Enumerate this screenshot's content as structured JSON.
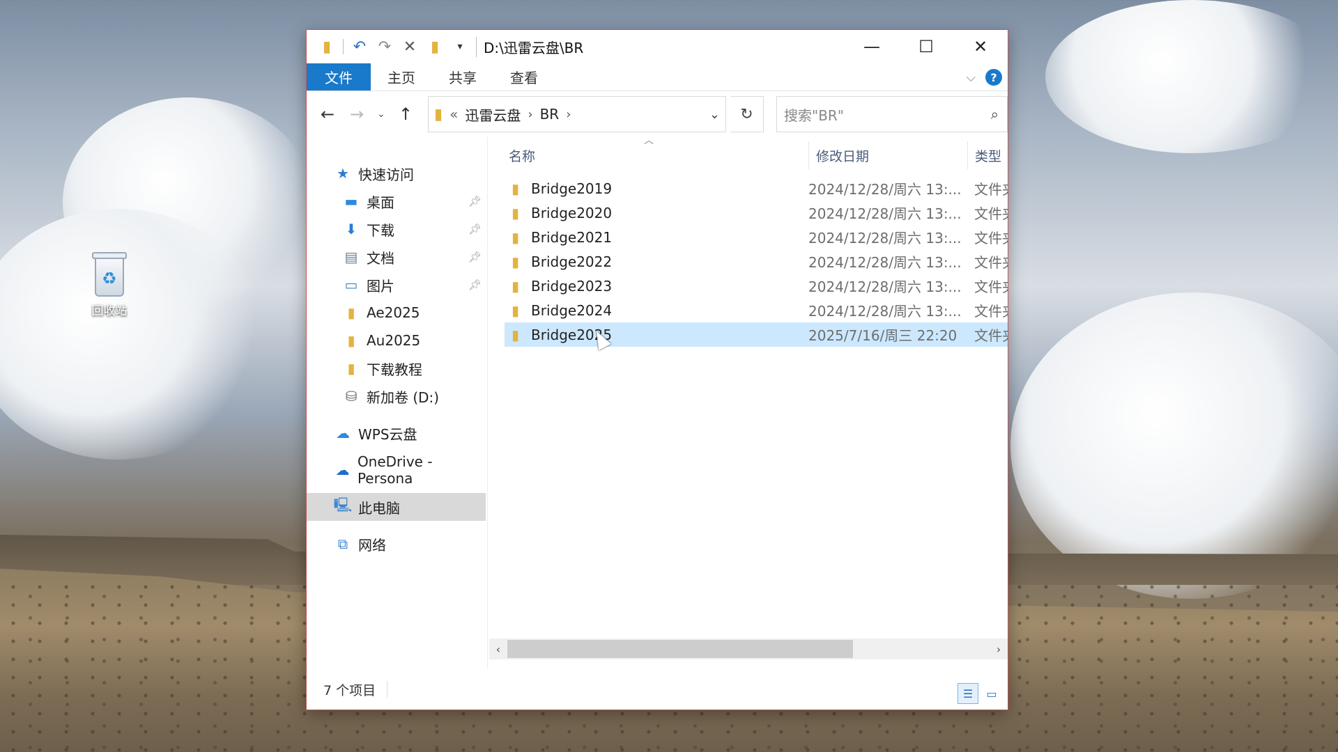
{
  "desktop": {
    "recycle_bin_label": "回收站"
  },
  "window": {
    "title": "D:\\迅雷云盘\\BR",
    "quick_access_toolbar": [
      "folder-icon",
      "undo-icon",
      "redo-icon",
      "delete-icon",
      "new-folder-icon",
      "customize-dropdown-icon"
    ],
    "controls": {
      "minimize": "—",
      "maximize": "☐",
      "close": "✕"
    }
  },
  "ribbon": {
    "tabs": [
      {
        "label": "文件",
        "active": true
      },
      {
        "label": "主页"
      },
      {
        "label": "共享"
      },
      {
        "label": "查看"
      }
    ],
    "help": "?"
  },
  "navigation": {
    "breadcrumb_prefix": "«",
    "breadcrumb": [
      "迅雷云盘",
      "BR"
    ],
    "search_placeholder": "搜索\"BR\""
  },
  "sidebar": {
    "items": [
      {
        "label": "快速访问",
        "icon": "star-icon",
        "level": 1
      },
      {
        "label": "桌面",
        "icon": "desktop-icon",
        "level": 2,
        "pinned": true
      },
      {
        "label": "下载",
        "icon": "download-icon",
        "level": 2,
        "pinned": true
      },
      {
        "label": "文档",
        "icon": "document-icon",
        "level": 2,
        "pinned": true
      },
      {
        "label": "图片",
        "icon": "pictures-icon",
        "level": 2,
        "pinned": true
      },
      {
        "label": "Ae2025",
        "icon": "folder-icon",
        "level": 2
      },
      {
        "label": "Au2025",
        "icon": "folder-icon",
        "level": 2
      },
      {
        "label": "下载教程",
        "icon": "folder-icon",
        "level": 2
      },
      {
        "label": "新加卷 (D:)",
        "icon": "drive-icon",
        "level": 2
      },
      {
        "label": "WPS云盘",
        "icon": "cloud-icon",
        "level": 1
      },
      {
        "label": "OneDrive - Persona",
        "icon": "onedrive-icon",
        "level": 1
      },
      {
        "label": "此电脑",
        "icon": "computer-icon",
        "level": 1,
        "selected": true
      },
      {
        "label": "网络",
        "icon": "network-icon",
        "level": 1
      }
    ]
  },
  "file_list": {
    "columns": [
      "名称",
      "修改日期",
      "类型"
    ],
    "rows": [
      {
        "name": "Bridge2019",
        "date": "2024/12/28/周六 13:...",
        "type": "文件夹"
      },
      {
        "name": "Bridge2020",
        "date": "2024/12/28/周六 13:...",
        "type": "文件夹"
      },
      {
        "name": "Bridge2021",
        "date": "2024/12/28/周六 13:...",
        "type": "文件夹"
      },
      {
        "name": "Bridge2022",
        "date": "2024/12/28/周六 13:...",
        "type": "文件夹"
      },
      {
        "name": "Bridge2023",
        "date": "2024/12/28/周六 13:...",
        "type": "文件夹"
      },
      {
        "name": "Bridge2024",
        "date": "2024/12/28/周六 13:...",
        "type": "文件夹"
      },
      {
        "name": "Bridge2025",
        "date": "2025/7/16/周三 22:20",
        "type": "文件夹",
        "selected": true
      }
    ]
  },
  "status": {
    "item_count": "7 个项目"
  },
  "colors": {
    "accent": "#1979ca",
    "selection": "#cce8ff",
    "folder": "#e3b341",
    "window_border": "#c25a5a"
  }
}
